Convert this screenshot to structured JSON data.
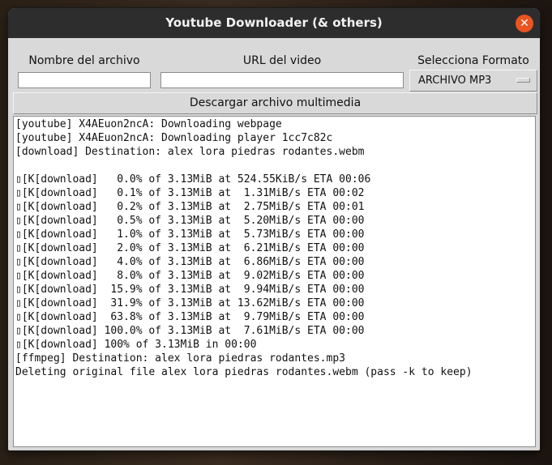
{
  "window": {
    "title": "Youtube Downloader (& others)",
    "close_glyph": "✕"
  },
  "form": {
    "filename_label": "Nombre del archivo",
    "filename_value": "",
    "url_label": "URL del video",
    "url_value": "",
    "format_label": "Selecciona Formato",
    "format_selected": "ARCHIVO MP3"
  },
  "download_button": "Descargar archivo multimedia",
  "console": {
    "lines": [
      "[youtube] X4AEuon2ncA: Downloading webpage",
      "[youtube] X4AEuon2ncA: Downloading player 1cc7c82c",
      "[download] Destination: alex lora piedras rodantes.webm",
      "",
      "▯[K[download]   0.0% of 3.13MiB at 524.55KiB/s ETA 00:06",
      "▯[K[download]   0.1% of 3.13MiB at  1.31MiB/s ETA 00:02",
      "▯[K[download]   0.2% of 3.13MiB at  2.75MiB/s ETA 00:01",
      "▯[K[download]   0.5% of 3.13MiB at  5.20MiB/s ETA 00:00",
      "▯[K[download]   1.0% of 3.13MiB at  5.73MiB/s ETA 00:00",
      "▯[K[download]   2.0% of 3.13MiB at  6.21MiB/s ETA 00:00",
      "▯[K[download]   4.0% of 3.13MiB at  6.86MiB/s ETA 00:00",
      "▯[K[download]   8.0% of 3.13MiB at  9.02MiB/s ETA 00:00",
      "▯[K[download]  15.9% of 3.13MiB at  9.94MiB/s ETA 00:00",
      "▯[K[download]  31.9% of 3.13MiB at 13.62MiB/s ETA 00:00",
      "▯[K[download]  63.8% of 3.13MiB at  9.79MiB/s ETA 00:00",
      "▯[K[download] 100.0% of 3.13MiB at  7.61MiB/s ETA 00:00",
      "▯[K[download] 100% of 3.13MiB in 00:00",
      "[ffmpeg] Destination: alex lora piedras rodantes.mp3",
      "Deleting original file alex lora piedras rodantes.webm (pass -k to keep)"
    ]
  },
  "colors": {
    "titlebar": "#2d2d2d",
    "window_bg": "#d9d9d9",
    "close_button": "#e95420",
    "console_bg": "#ffffff"
  }
}
